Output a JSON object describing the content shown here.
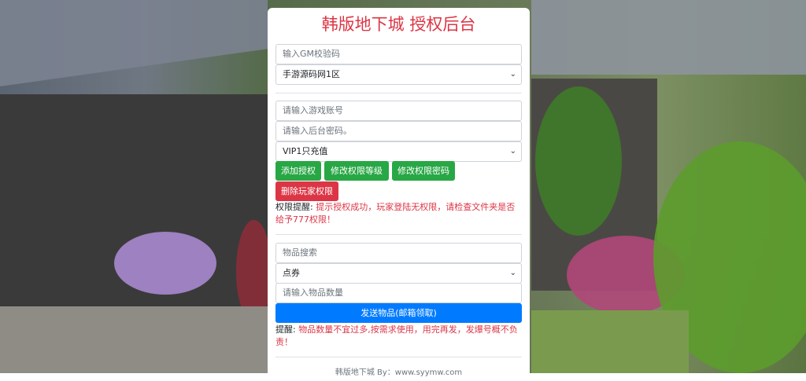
{
  "title": "韩版地下城 授权后台",
  "gm_code": {
    "placeholder": "输入GM校验码"
  },
  "server_select": {
    "value": "手游源码网1区"
  },
  "account": {
    "placeholder": "请输入游戏账号"
  },
  "admin_password": {
    "placeholder": "请输入后台密码。"
  },
  "vip_select": {
    "value": "VIP1只充值"
  },
  "buttons": {
    "add_auth": "添加授权",
    "modify_level": "修改权限等级",
    "modify_password": "修改权限密码",
    "delete_auth": "删除玩家权限",
    "send_item": "发送物品(邮箱领取)"
  },
  "auth_notice": {
    "label": "权限提醒:",
    "text": "提示授权成功，玩家登陆无权限，请检查文件夹是否给予777权限！"
  },
  "item_search": {
    "placeholder": "物品搜索"
  },
  "item_select": {
    "value": "点券"
  },
  "item_quantity": {
    "placeholder": "请输入物品数量"
  },
  "send_notice": {
    "label": "提醒:",
    "text": "物品数量不宜过多,按需求使用，用完再发，发爆号概不负责！"
  },
  "footer": {
    "text": "韩版地下城 By：www.syymw.com"
  },
  "colors": {
    "accent_red": "#dc3545",
    "green": "#28a745",
    "blue": "#007bff"
  }
}
